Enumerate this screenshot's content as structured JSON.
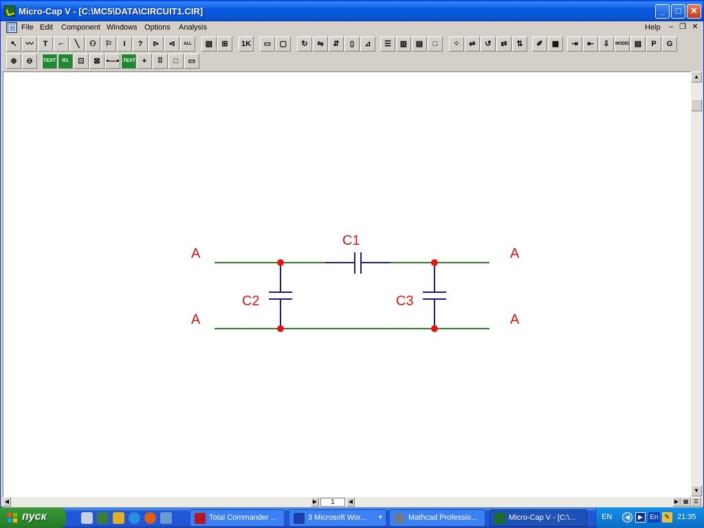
{
  "window": {
    "title": "Micro-Cap V - [C:\\MC5\\DATA\\CIRCUIT1.CIR]",
    "controls": {
      "minimize": "_",
      "maximize": "□",
      "close": "✕"
    }
  },
  "menu": {
    "items": [
      "File",
      "Edit",
      "Component",
      "Windows",
      "Options",
      "Analysis"
    ],
    "help": "Help",
    "mdi_controls": [
      "–",
      "❐",
      "✕"
    ]
  },
  "toolbar1": {
    "buttons": [
      {
        "icon": "select-arrow-icon",
        "glyph": "↖"
      },
      {
        "icon": "wire-wave-icon",
        "glyph": "〰"
      },
      {
        "icon": "text-tool-icon",
        "glyph": "T"
      },
      {
        "icon": "orthogonal-wire-icon",
        "glyph": "⌐"
      },
      {
        "icon": "diagonal-wire-icon",
        "glyph": "╲"
      },
      {
        "icon": "component-icon",
        "glyph": "⚇"
      },
      {
        "icon": "flag-icon",
        "glyph": "⚐"
      },
      {
        "icon": "info-icon",
        "glyph": "I"
      },
      {
        "icon": "help-icon",
        "glyph": "?"
      },
      {
        "icon": "pin-left-icon",
        "glyph": "⊳"
      },
      {
        "icon": "pin-right-icon",
        "glyph": "⊲"
      },
      {
        "icon": "all-text-icon",
        "glyph": "ALL"
      },
      {
        "icon": "hatch-icon",
        "glyph": "▨"
      },
      {
        "icon": "grid-toggle-icon",
        "glyph": "⊞"
      },
      {
        "icon": "value-icon",
        "glyph": "1K"
      },
      {
        "icon": "box-icon",
        "glyph": "▭"
      },
      {
        "icon": "box-select-icon",
        "glyph": "▢"
      },
      {
        "icon": "rotate-icon",
        "glyph": "↻"
      },
      {
        "icon": "mirror-icon",
        "glyph": "⇋"
      },
      {
        "icon": "flip-icon",
        "glyph": "⇵"
      },
      {
        "icon": "step-icon",
        "glyph": "▯"
      },
      {
        "icon": "step-right-icon",
        "glyph": "⊿"
      },
      {
        "icon": "tile-horizontal-icon",
        "glyph": "☰"
      },
      {
        "icon": "tile-vertical-icon",
        "glyph": "▥"
      },
      {
        "icon": "cascade-icon",
        "glyph": "▤"
      },
      {
        "icon": "blank-window-icon",
        "glyph": "□"
      },
      {
        "icon": "node-numbers-icon",
        "glyph": "⁘"
      },
      {
        "icon": "pin-connect-icon",
        "glyph": "⇌"
      },
      {
        "icon": "rotate-left-icon",
        "glyph": "↺"
      },
      {
        "icon": "swap-icon",
        "glyph": "⇄"
      },
      {
        "icon": "flip-vertical-icon",
        "glyph": "⇅"
      },
      {
        "icon": "probe-icon",
        "glyph": "✐"
      },
      {
        "icon": "calculator-icon",
        "glyph": "▦"
      },
      {
        "icon": "save-in-icon",
        "glyph": "⇥"
      },
      {
        "icon": "save-out-icon",
        "glyph": "⇤"
      },
      {
        "icon": "save-down-icon",
        "glyph": "⇩"
      },
      {
        "icon": "model-icon",
        "glyph": "MODEL"
      },
      {
        "icon": "table-icon",
        "glyph": "▤"
      },
      {
        "icon": "p-icon",
        "glyph": "P"
      },
      {
        "icon": "g-icon",
        "glyph": "G"
      }
    ]
  },
  "toolbar2": {
    "buttons": [
      {
        "icon": "zoom-in-icon",
        "glyph": "⊕",
        "green": false
      },
      {
        "icon": "zoom-out-icon",
        "glyph": "⊖",
        "green": false
      },
      {
        "icon": "text-label-icon",
        "glyph": "TEXT",
        "green": true
      },
      {
        "icon": "attribute-icon",
        "glyph": "R1",
        "green": true
      },
      {
        "icon": "pin-names-icon",
        "glyph": "⊡",
        "green": false
      },
      {
        "icon": "node-icon",
        "glyph": "⊠",
        "green": false
      },
      {
        "icon": "pin-connection-icon",
        "glyph": "•—•",
        "green": false
      },
      {
        "icon": "net-text-icon",
        "glyph": ".TEXT",
        "green": true
      },
      {
        "icon": "cross-icon",
        "glyph": "+",
        "green": false
      },
      {
        "icon": "grid-dots-icon",
        "glyph": "⠿",
        "green": false
      },
      {
        "icon": "frame-icon",
        "glyph": "□",
        "green": false
      },
      {
        "icon": "title-block-icon",
        "glyph": "▭",
        "green": false
      }
    ]
  },
  "schematic": {
    "colors": {
      "wire": "#1c8a1c",
      "capacitor": "#1a1a8c",
      "label": "#e01010",
      "node": "#ee1010"
    },
    "labels": {
      "c1": "C1",
      "c2": "C2",
      "c3": "C3",
      "a_top_left": "A",
      "a_bottom_left": "A",
      "a_top_right": "A",
      "a_bottom_right": "A"
    }
  },
  "scrollbars": {
    "page_number": "1"
  },
  "taskbar": {
    "start_label": "пуск",
    "tasks": [
      {
        "label": "Total Commander ...",
        "active": false,
        "color": "#b8161e"
      },
      {
        "label": "3 Microsoft Wor...",
        "active": false,
        "color": "#1a3fa8"
      },
      {
        "label": "Mathcad Professio...",
        "active": false,
        "color": "#6e7a8a"
      },
      {
        "label": "Micro-Cap V - [C:\\...",
        "active": true,
        "color": "#1d6b28"
      }
    ],
    "tray": {
      "language": "EN",
      "clock": "21:35"
    }
  }
}
